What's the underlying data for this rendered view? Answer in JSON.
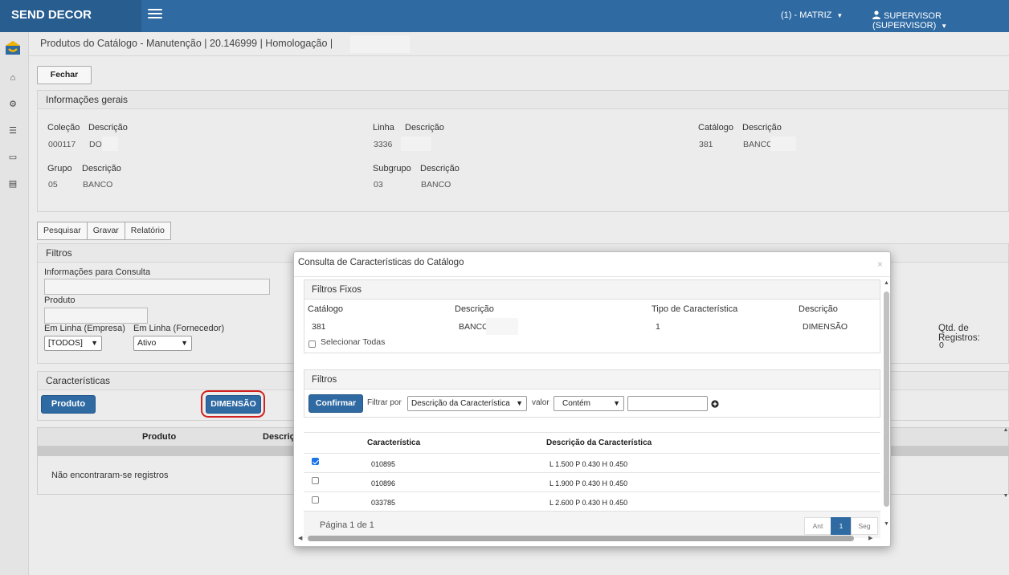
{
  "app": {
    "brand": "SEND DECOR",
    "branch": "(1) - MATRIZ",
    "user": "SUPERVISOR (SUPERVISOR)"
  },
  "page": {
    "title": "Produtos do Catálogo - Manutenção | 20.146999 | Homologação |",
    "close_label": "Fechar"
  },
  "info": {
    "heading": "Informações gerais",
    "colecao_label": "Coleção",
    "colecao_desc_label": "Descrição",
    "colecao_value": "000117",
    "colecao_desc": "DO",
    "linha_label": "Linha",
    "linha_desc_label": "Descrição",
    "linha_value": "3336",
    "catalogo_label": "Catálogo",
    "catalogo_desc_label": "Descrição",
    "catalogo_value": "381",
    "catalogo_desc": "BANCO F",
    "grupo_label": "Grupo",
    "grupo_desc_label": "Descrição",
    "grupo_value": "05",
    "grupo_desc": "BANCO",
    "subgrupo_label": "Subgrupo",
    "subgrupo_desc_label": "Descrição",
    "subgrupo_value": "03",
    "subgrupo_desc": "BANCO"
  },
  "actions": {
    "pesquisar": "Pesquisar",
    "gravar": "Gravar",
    "relatorio": "Relatório"
  },
  "filters": {
    "heading": "Filtros",
    "consulta_label": "Informações para Consulta",
    "produto_label": "Produto",
    "linha_empresa_label": "Em Linha (Empresa)",
    "linha_empresa_value": "[TODOS]",
    "linha_fornecedor_label": "Em Linha (Fornecedor)",
    "linha_fornecedor_value": "Ativo",
    "qtd_label": "Qtd. de Registros:",
    "qtd_value": "0"
  },
  "caracteristicas": {
    "heading": "Características",
    "produto_button": "Produto",
    "dimensao_button": "DIMENSÃO",
    "col_produto": "Produto",
    "col_descricao": "Descriçã",
    "empty": "Não encontraram-se registros"
  },
  "dialog": {
    "title": "Consulta de Características do Catálogo",
    "close": "×",
    "fixos_heading": "Filtros Fixos",
    "catalogo_label": "Catálogo",
    "catalogo_value": "381",
    "descricao_label": "Descrição",
    "descricao_value": "BANCO",
    "tipo_label": "Tipo de Característica",
    "tipo_value": "1",
    "tipo_desc_label": "Descrição",
    "tipo_desc_value": "DIMENSÃO",
    "select_all_label": "Selecionar Todas",
    "filtros_heading": "Filtros",
    "confirm_button": "Confirmar",
    "filtrar_por_label": "Filtrar por",
    "filtrar_por_value": "Descrição da Característica",
    "valor_label": "valor",
    "operator_value": "Contém",
    "search_value": "",
    "table": {
      "col_caracteristica": "Característica",
      "col_descricao": "Descrição da Característica",
      "rows": [
        {
          "checked": true,
          "code": "010895",
          "desc": "L 1.500 P 0.430 H 0.450"
        },
        {
          "checked": false,
          "code": "010896",
          "desc": "L 1.900 P 0.430 H 0.450"
        },
        {
          "checked": false,
          "code": "033785",
          "desc": "L 2.600 P 0.430 H 0.450"
        }
      ]
    },
    "pagination": {
      "info": "Página 1 de 1",
      "prev": "Ant",
      "current": "1",
      "next": "Seg"
    }
  }
}
